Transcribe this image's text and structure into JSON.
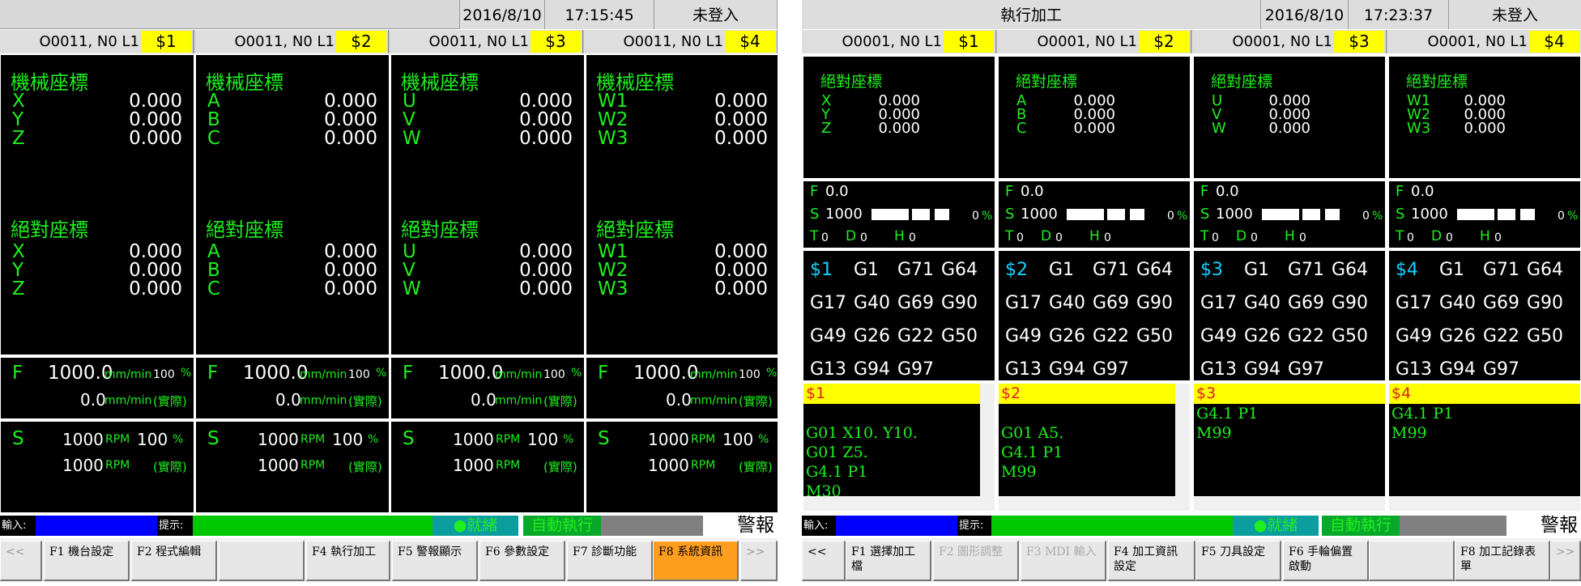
{
  "left": {
    "date": "2016/8/10",
    "time": "17:15:45",
    "login": "未登入",
    "tabs": [
      {
        "name": "O0011, N0 L1",
        "ch": "$1"
      },
      {
        "name": "O0011, N0 L1",
        "ch": "$2"
      },
      {
        "name": "O0011, N0 L1",
        "ch": "$3"
      },
      {
        "name": "O0011, N0 L1",
        "ch": "$4"
      }
    ],
    "mech_title": "機械座標",
    "abs_title": "絕對座標",
    "channels": [
      {
        "axes": [
          "X",
          "Y",
          "Z"
        ],
        "mech": [
          "0.000",
          "0.000",
          "0.000"
        ],
        "abs": [
          "0.000",
          "0.000",
          "0.000"
        ]
      },
      {
        "axes": [
          "A",
          "B",
          "C"
        ],
        "mech": [
          "0.000",
          "0.000",
          "0.000"
        ],
        "abs": [
          "0.000",
          "0.000",
          "0.000"
        ]
      },
      {
        "axes": [
          "U",
          "V",
          "W"
        ],
        "mech": [
          "0.000",
          "0.000",
          "0.000"
        ],
        "abs": [
          "0.000",
          "0.000",
          "0.000"
        ]
      },
      {
        "axes": [
          "W1",
          "W2",
          "W3"
        ],
        "mech": [
          "0.000",
          "0.000",
          "0.000"
        ],
        "abs": [
          "0.000",
          "0.000",
          "0.000"
        ]
      }
    ],
    "feed": {
      "label": "F",
      "value": "1000.0",
      "unit": "mm/min",
      "pct": "100",
      "pctsign": "%",
      "actual": "0.0",
      "actual_label": "(實際)"
    },
    "spindle": {
      "label": "S",
      "value": "1000",
      "unit": "RPM",
      "pct": "100",
      "pctsign": "%",
      "actual": "1000",
      "actual_label": "(實際)"
    },
    "input_label": "輸入:",
    "hint_label": "提示:",
    "ready": "●就緒",
    "auto": "自動執行",
    "alarm": "警報",
    "fkeys": [
      "<<",
      "F1 機台設定",
      "F2 程式編輯",
      "",
      "F4 執行加工",
      "F5 警報顯示",
      "F6 參數設定",
      "F7 診斷功能",
      "F8 系統資訊",
      ">>"
    ]
  },
  "right": {
    "title": "執行加工",
    "date": "2016/8/10",
    "time": "17:23:37",
    "login": "未登入",
    "tabs": [
      {
        "name": "O0001, N0 L1",
        "ch": "$1"
      },
      {
        "name": "O0001, N0 L1",
        "ch": "$2"
      },
      {
        "name": "O0001, N0 L1",
        "ch": "$3"
      },
      {
        "name": "O0001, N0 L1",
        "ch": "$4"
      }
    ],
    "abs_title": "絕對座標",
    "channels": [
      {
        "axes": [
          "X",
          "Y",
          "Z"
        ],
        "abs": [
          "0.000",
          "0.000",
          "0.000"
        ],
        "ch": "$1",
        "prog": [
          "G01 X10. Y10.",
          "G01 Z5.",
          "G4.1 P1",
          "M30"
        ],
        "blank_first": true,
        "scroll": true
      },
      {
        "axes": [
          "A",
          "B",
          "C"
        ],
        "abs": [
          "0.000",
          "0.000",
          "0.000"
        ],
        "ch": "$2",
        "prog": [
          "G01 A5.",
          "G4.1 P1",
          "M99"
        ],
        "blank_first": true,
        "scroll": true
      },
      {
        "axes": [
          "U",
          "V",
          "W"
        ],
        "abs": [
          "0.000",
          "0.000",
          "0.000"
        ],
        "ch": "$3",
        "prog": [
          "G4.1 P1",
          "M99"
        ],
        "blank_first": false,
        "scroll": false
      },
      {
        "axes": [
          "W1",
          "W2",
          "W3"
        ],
        "abs": [
          "0.000",
          "0.000",
          "0.000"
        ],
        "ch": "$4",
        "prog": [
          "G4.1 P1",
          "M99"
        ],
        "blank_first": false,
        "scroll": false
      }
    ],
    "status": {
      "f_label": "F",
      "f": "0.0",
      "s_label": "S",
      "s": "1000",
      "pct": "0",
      "pctsign": "%",
      "t_label": "T",
      "t": "0",
      "d_label": "D",
      "d": "0",
      "h_label": "H",
      "h": "0"
    },
    "gcodes": [
      [
        "G1",
        "G71",
        "G64"
      ],
      [
        "G17",
        "G40",
        "G69",
        "G90"
      ],
      [
        "G49",
        "G26",
        "G22",
        "G50"
      ],
      [
        "G13",
        "G94",
        "G97"
      ]
    ],
    "input_label": "輸入:",
    "hint_label": "提示:",
    "ready": "●就緒",
    "auto": "自動執行",
    "alarm": "警報",
    "fkeys": [
      "<<",
      "F1 選擇加工檔",
      "F2 圖形調整",
      "F3 MDI 輸入",
      "F4 加工資訊設定",
      "F5 刀具設定",
      "F6 手輪偏置啟動",
      "",
      "F8 加工記錄表單",
      ">>"
    ],
    "fkeys_disabled": [
      2,
      3
    ]
  },
  "colors": {
    "green": "#1ef01e",
    "yellow": "#ffff00",
    "blue": "#0000ff",
    "ready_bg": "#0c9e9e",
    "auto_bg": "#0aa82a",
    "fkey_active": "#ff9d1e"
  }
}
